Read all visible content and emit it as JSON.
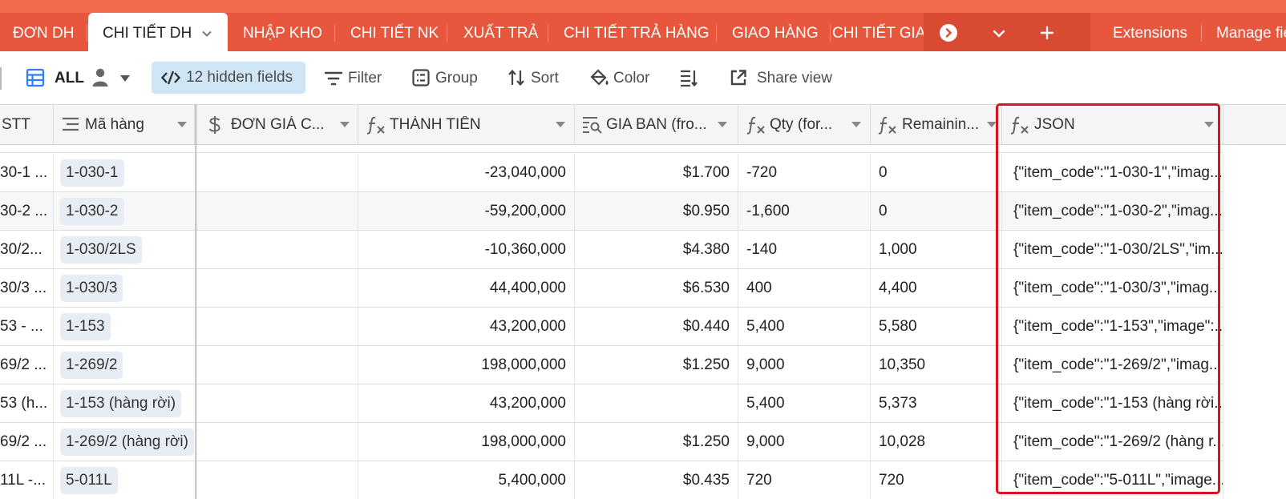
{
  "tabs": {
    "items": [
      "ĐƠN DH",
      "CHI TIẾT DH",
      "NHẬP KHO",
      "CHI TIẾT NK",
      "XUẤT TRẢ",
      "CHI TIẾT TRẢ HÀNG",
      "GIAO HÀNG",
      "CHI TIẾT GIAO HÀNG"
    ],
    "active_index": 1,
    "extensions_label": "Extensions",
    "manage_label": "Manage fields"
  },
  "toolbar": {
    "view_name": "ALL",
    "hidden_fields": "12 hidden fields",
    "filter": "Filter",
    "group": "Group",
    "sort": "Sort",
    "color": "Color",
    "share_view": "Share view"
  },
  "columns": [
    "STT",
    "Mã hàng",
    "ĐƠN GIÁ C...",
    "THÀNH TIỀN",
    "GIA BAN (fro...",
    "Qty (for...",
    "Remainin...",
    "JSON"
  ],
  "rows": [
    {
      "stt": "30-1 ...",
      "ma_hang": "1-030-1",
      "don_gia": "",
      "thanh_tien": "-23,040,000",
      "gia_ban": "$1.700",
      "qty": "-720",
      "remaining": "0",
      "json": "{\"item_code\":\"1-030-1\",\"imag..."
    },
    {
      "stt": "30-2 ...",
      "ma_hang": "1-030-2",
      "don_gia": "",
      "thanh_tien": "-59,200,000",
      "gia_ban": "$0.950",
      "qty": "-1,600",
      "remaining": "0",
      "json": "{\"item_code\":\"1-030-2\",\"imag..."
    },
    {
      "stt": "30/2...",
      "ma_hang": "1-030/2LS",
      "don_gia": "",
      "thanh_tien": "-10,360,000",
      "gia_ban": "$4.380",
      "qty": "-140",
      "remaining": "1,000",
      "json": "{\"item_code\":\"1-030/2LS\",\"im..."
    },
    {
      "stt": "30/3 ...",
      "ma_hang": "1-030/3",
      "don_gia": "",
      "thanh_tien": "44,400,000",
      "gia_ban": "$6.530",
      "qty": "400",
      "remaining": "4,400",
      "json": "{\"item_code\":\"1-030/3\",\"imag..."
    },
    {
      "stt": "53 - ...",
      "ma_hang": "1-153",
      "don_gia": "",
      "thanh_tien": "43,200,000",
      "gia_ban": "$0.440",
      "qty": "5,400",
      "remaining": "5,580",
      "json": "{\"item_code\":\"1-153\",\"image\":..."
    },
    {
      "stt": "69/2 ...",
      "ma_hang": "1-269/2",
      "don_gia": "",
      "thanh_tien": "198,000,000",
      "gia_ban": "$1.250",
      "qty": "9,000",
      "remaining": "10,350",
      "json": "{\"item_code\":\"1-269/2\",\"imag..."
    },
    {
      "stt": "53 (h...",
      "ma_hang": "1-153 (hàng rời)",
      "don_gia": "",
      "thanh_tien": "43,200,000",
      "gia_ban": "",
      "qty": "5,400",
      "remaining": "5,373",
      "json": "{\"item_code\":\"1-153 (hàng rời..."
    },
    {
      "stt": "69/2 ...",
      "ma_hang": "1-269/2 (hàng rời)",
      "don_gia": "",
      "thanh_tien": "198,000,000",
      "gia_ban": "$1.250",
      "qty": "9,000",
      "remaining": "10,028",
      "json": "{\"item_code\":\"1-269/2 (hàng r..."
    },
    {
      "stt": "11L -...",
      "ma_hang": "5-011L",
      "don_gia": "",
      "thanh_tien": "5,400,000",
      "gia_ban": "$0.435",
      "qty": "720",
      "remaining": "720",
      "json": "{\"item_code\":\"5-011L\",\"image..."
    }
  ],
  "colors": {
    "tabbar": "#e8573d",
    "highlight": "#d9141d",
    "hidden_fields_bg": "#cfe6f7",
    "chip_bg": "#e8ecf4"
  }
}
